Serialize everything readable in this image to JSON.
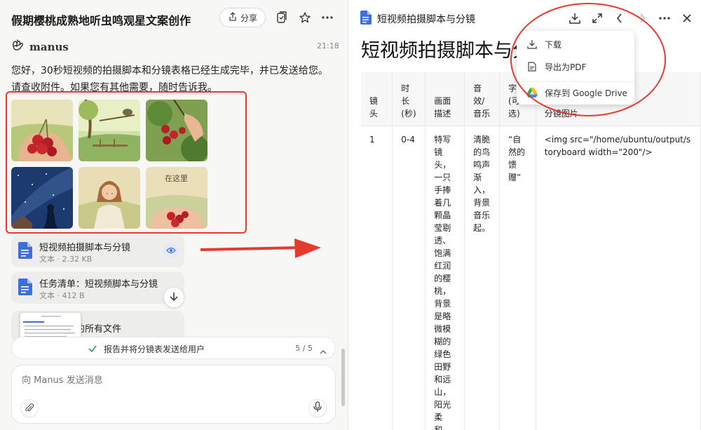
{
  "left": {
    "title": "假期樱桃成熟地听虫鸣观星文案创作",
    "share_label": "分享",
    "sender": "manus",
    "time": "21:18",
    "message": "您好，30秒短视频的拍摄脚本和分镜表格已经生成完毕，并已发送给您。请查收附件。如果您有其他需要，随时告诉我。",
    "thumb_text": "在这里",
    "files": [
      {
        "name": "短视频拍摄脚本与分镜",
        "meta": "文本 · 2.32 KB"
      },
      {
        "name": "任务清单：短视频脚本与分镜",
        "meta": "文本 · 412 B"
      },
      {
        "name": "此任务中的所有文件",
        "meta": ""
      }
    ],
    "task": {
      "text": "报告并将分镜表发送给用户",
      "count": "5 / 5"
    },
    "input_placeholder": "向 Manus 发送消息"
  },
  "right": {
    "doc_title": "短视频拍摄脚本与分镜",
    "heading": "短视频拍摄脚本与分",
    "table": {
      "headers": [
        "镜头",
        "时长(秒)",
        "画面描述",
        "音效/音乐",
        "字幕(可选)",
        "分镜图片"
      ],
      "row": {
        "shot": "1",
        "duration": "0-4",
        "description": "特写镜头，一只手捧着几颗晶莹剔透、饱满红润的樱桃，背景是略微模糊的绿色田野和远山，阳光柔和。",
        "audio": "清脆的鸟鸣声渐入，背景音乐起。",
        "subtitle": "“自然的馈赠”",
        "image": "<img src=\"/home/ubuntu/output/storyboard width=\"200\"/>"
      }
    }
  },
  "menu": {
    "items": [
      {
        "label": "下载",
        "icon": "download-icon"
      },
      {
        "label": "导出为PDF",
        "icon": "pdf-icon"
      },
      {
        "label": "保存到 Google Drive",
        "icon": "google-drive-icon"
      }
    ]
  },
  "colors": {
    "annotation_red": "#e53a2c",
    "doc_blue": "#3d6fdb",
    "panel_bg": "#f7f7f6"
  }
}
